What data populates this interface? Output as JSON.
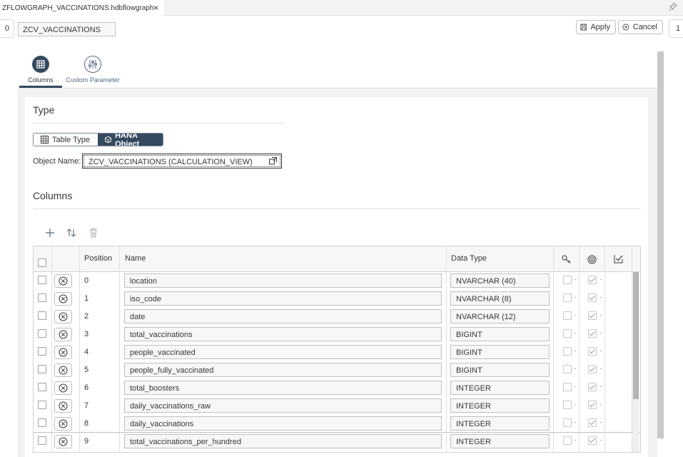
{
  "tab": {
    "title": "ZFLOWGRAPH_VACCINATIONS.hdbflowgraph",
    "close": "×"
  },
  "header": {
    "left_count": "0",
    "node_name": "ZCV_VACCINATIONS",
    "apply": "Apply",
    "cancel": "Cancel",
    "right_count": "1"
  },
  "subtabs": {
    "columns": "Columns",
    "custom": "Custom Parameter"
  },
  "type_section": {
    "title": "Type",
    "table_type": "Table Type",
    "hana_object": "HANA Object",
    "object_label": "Object Name:",
    "object_value": "ZCV_VACCINATIONS (CALCULATION_VIEW)"
  },
  "columns_section": {
    "title": "Columns",
    "headers": {
      "position": "Position",
      "name": "Name",
      "data_type": "Data Type"
    },
    "rows": [
      {
        "position": "0",
        "name": "location",
        "type": "NVARCHAR (40)"
      },
      {
        "position": "1",
        "name": "iso_code",
        "type": "NVARCHAR (8)"
      },
      {
        "position": "2",
        "name": "date",
        "type": "NVARCHAR (12)"
      },
      {
        "position": "3",
        "name": "total_vaccinations",
        "type": "BIGINT"
      },
      {
        "position": "4",
        "name": "people_vaccinated",
        "type": "BIGINT"
      },
      {
        "position": "5",
        "name": "people_fully_vaccinated",
        "type": "BIGINT"
      },
      {
        "position": "6",
        "name": "total_boosters",
        "type": "INTEGER"
      },
      {
        "position": "7",
        "name": "daily_vaccinations_raw",
        "type": "INTEGER"
      },
      {
        "position": "8",
        "name": "daily_vaccinations",
        "type": "INTEGER"
      },
      {
        "position": "9",
        "name": "total_vaccinations_per_hundred",
        "type": "INTEGER"
      }
    ]
  },
  "colors": {
    "accent": "#354a5f",
    "panel_bg": "#f2f2f2",
    "border": "#bfbfbf"
  },
  "icons": [
    "pin-icon",
    "save-icon",
    "cancel-icon",
    "table-icon",
    "hana-object-icon",
    "value-help-icon",
    "add-icon",
    "sort-icon",
    "delete-icon",
    "remove-row-icon",
    "key-icon",
    "target-icon",
    "check-header-icon"
  ]
}
